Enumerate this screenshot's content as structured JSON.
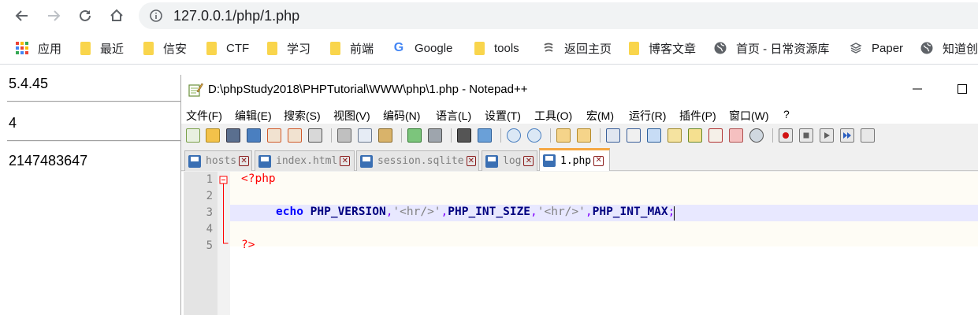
{
  "browser": {
    "url": "127.0.0.1/php/1.php",
    "bookmarks": [
      {
        "label": "应用",
        "icon": "apps-grid-icon"
      },
      {
        "label": "最近",
        "icon": "folder-icon"
      },
      {
        "label": "信安",
        "icon": "folder-icon"
      },
      {
        "label": "CTF",
        "icon": "folder-icon"
      },
      {
        "label": "学习",
        "icon": "folder-icon"
      },
      {
        "label": "前端",
        "icon": "folder-icon"
      },
      {
        "label": "Google",
        "icon": "google-icon"
      },
      {
        "label": "tools",
        "icon": "folder-icon"
      },
      {
        "label": "返回主页",
        "icon": "site-favicon-icon"
      },
      {
        "label": "博客文章",
        "icon": "folder-icon"
      },
      {
        "label": "首页 - 日常资源库",
        "icon": "globe-icon"
      },
      {
        "label": "Paper",
        "icon": "layers-icon"
      },
      {
        "label": "知道创",
        "icon": "globe-icon"
      }
    ]
  },
  "page": {
    "output": [
      "5.4.45",
      "4",
      "2147483647"
    ]
  },
  "notepad": {
    "title": "D:\\phpStudy2018\\PHPTutorial\\WWW\\php\\1.php - Notepad++",
    "menu": [
      "文件(F)",
      "编辑(E)",
      "搜索(S)",
      "视图(V)",
      "编码(N)",
      "语言(L)",
      "设置(T)",
      "工具(O)",
      "宏(M)",
      "运行(R)",
      "插件(P)",
      "窗口(W)",
      "?"
    ],
    "tabs": [
      {
        "label": "hosts",
        "active": false
      },
      {
        "label": "index.html",
        "active": false
      },
      {
        "label": "session.sqlite",
        "active": false
      },
      {
        "label": "log",
        "active": false
      },
      {
        "label": "1.php",
        "active": true
      }
    ],
    "line_numbers": [
      "1",
      "2",
      "3",
      "4",
      "5"
    ],
    "code": {
      "line1": "<?php",
      "line3": {
        "kw": "echo",
        "c1": "PHP_VERSION",
        "s1": "'<hr/>'",
        "c2": "PHP_INT_SIZE",
        "s2": "'<hr/>'",
        "c3": "PHP_INT_MAX",
        "comma": ",",
        "semi": ";"
      },
      "line5": "?>"
    }
  },
  "colors": {
    "tab_active_accent": "#f5a742",
    "keyword": "#0000ff",
    "php_tag": "#ff0000",
    "string": "#808080",
    "current_line": "#e8e8ff"
  }
}
